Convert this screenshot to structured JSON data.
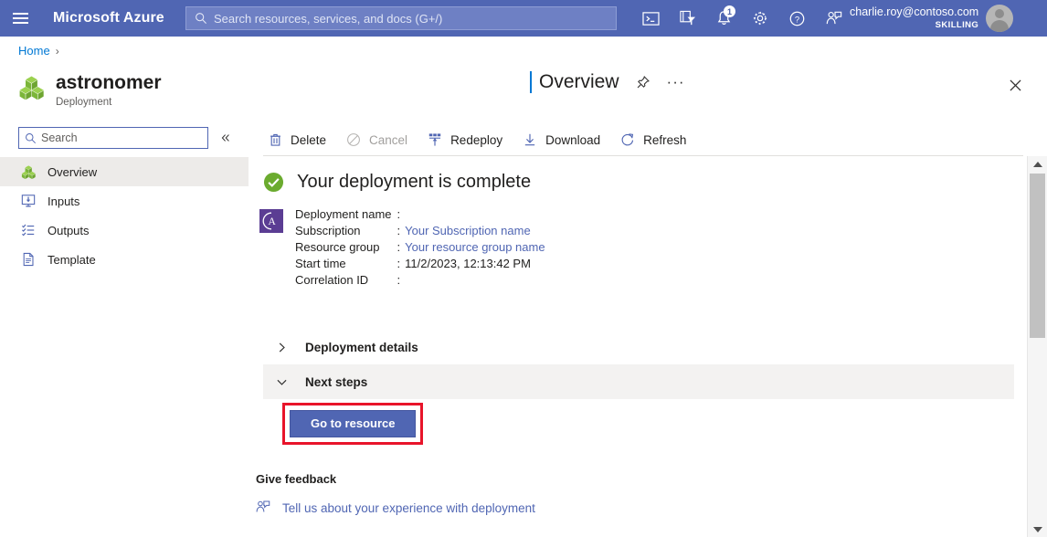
{
  "topbar": {
    "menu_icon": "hamburger-icon",
    "brand": "Microsoft Azure",
    "search": {
      "placeholder": "Search resources, services, and docs (G+/)",
      "value": "",
      "icon": "search-icon"
    },
    "icons": [
      {
        "name": "cloud-shell-icon",
        "label": "Cloud Shell"
      },
      {
        "name": "directories-subscriptions-icon",
        "label": "Directories + subscriptions"
      },
      {
        "name": "notifications-bell-icon",
        "label": "Notifications",
        "badge": "1"
      },
      {
        "name": "settings-gear-icon",
        "label": "Settings"
      },
      {
        "name": "help-question-icon",
        "label": "Help"
      },
      {
        "name": "feedback-person-icon",
        "label": "Feedback"
      }
    ],
    "account": {
      "email": "charlie.roy@contoso.com",
      "org": "SKILLING",
      "avatar": "user-avatar"
    }
  },
  "breadcrumb": {
    "items": [
      "Home"
    ],
    "separator": "›"
  },
  "resource": {
    "icon": "deployment-cubes-icon",
    "name": "astronomer",
    "type": "Deployment"
  },
  "blade": {
    "title": "Overview",
    "pin_icon": "pin-icon",
    "more_icon": "ellipsis-icon",
    "close_icon": "close-icon"
  },
  "sidebar": {
    "search": {
      "placeholder": "Search",
      "value": "",
      "icon": "search-icon"
    },
    "collapse_icon": "double-chevron-left-icon",
    "items": [
      {
        "label": "Overview",
        "icon": "overview-cubes-icon",
        "selected": true
      },
      {
        "label": "Inputs",
        "icon": "inputs-icon",
        "selected": false
      },
      {
        "label": "Outputs",
        "icon": "outputs-list-icon",
        "selected": false
      },
      {
        "label": "Template",
        "icon": "template-document-icon",
        "selected": false
      }
    ]
  },
  "toolbar": {
    "commands": [
      {
        "label": "Delete",
        "icon": "trash-icon",
        "disabled": false
      },
      {
        "label": "Cancel",
        "icon": "cancel-circle-icon",
        "disabled": true
      },
      {
        "label": "Redeploy",
        "icon": "redeploy-icon",
        "disabled": false
      },
      {
        "label": "Download",
        "icon": "download-arrow-icon",
        "disabled": false
      },
      {
        "label": "Refresh",
        "icon": "refresh-circle-icon",
        "disabled": false
      }
    ]
  },
  "main": {
    "status": {
      "icon": "success-check-icon",
      "text": "Your deployment is complete"
    },
    "deployment_icon": "astronomer-a-icon",
    "details": [
      {
        "key": "Deployment name",
        "colon": ":",
        "value": "",
        "is_link": false
      },
      {
        "key": "Subscription",
        "colon": ":",
        "value": "Your Subscription name",
        "is_link": true
      },
      {
        "key": "Resource group",
        "colon": ":",
        "value": "Your resource group name",
        "is_link": true
      },
      {
        "key": "Start time",
        "colon": ":",
        "value": "11/2/2023, 12:13:42 PM",
        "is_link": false
      },
      {
        "key": "Correlation ID",
        "colon": ":",
        "value": "",
        "is_link": false
      }
    ],
    "accordions": [
      {
        "label": "Deployment details",
        "expanded": false,
        "chevron": "chevron-right-icon",
        "shaded": false
      },
      {
        "label": "Next steps",
        "expanded": true,
        "chevron": "chevron-down-icon",
        "shaded": true
      }
    ],
    "primary_button": {
      "label": "Go to resource",
      "highlight_color": "#e8142a",
      "background": "#5066b3"
    },
    "feedback": {
      "title": "Give feedback",
      "link_icon": "feedback-person-icon",
      "link_text": "Tell us about your experience with deployment"
    }
  },
  "scrollbar": {
    "up_icon": "scroll-up-arrow-icon",
    "down_icon": "scroll-down-arrow-icon",
    "thumb": "scrollbar-thumb"
  }
}
